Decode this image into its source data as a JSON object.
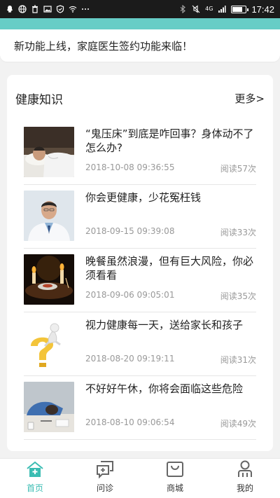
{
  "status_bar": {
    "time": "17:42",
    "network": "4G",
    "battery_level": 0.8,
    "left_icons": [
      "qq-icon",
      "globe-icon",
      "trash-icon",
      "image-icon",
      "shield-icon",
      "wifi-icon",
      "more-dots-icon"
    ],
    "right_icons": [
      "bluetooth-icon",
      "mute-icon",
      "signal-icon",
      "battery-icon"
    ]
  },
  "notice": {
    "text": "新功能上线，家庭医生签约功能来临！"
  },
  "health_section": {
    "title": "健康知识",
    "more_label": "更多>",
    "articles": [
      {
        "title": "“鬼压床”到底是咋回事？身体动不了怎么办?",
        "date": "2018-10-08 09:36:55",
        "views": "阅读57次",
        "thumb_icon": "sleeping-man-image"
      },
      {
        "title": "你会更健康，少花冤枉钱",
        "date": "2018-09-15 09:39:08",
        "views": "阅读33次",
        "thumb_icon": "doctor-portrait-image"
      },
      {
        "title": "晚餐虽然浪漫，但有巨大风险，你必须看看",
        "date": "2018-09-06 09:05:01",
        "views": "阅读35次",
        "thumb_icon": "candlelight-dinner-image"
      },
      {
        "title": "视力健康每一天，送给家长和孩子",
        "date": "2018-08-20 09:19:11",
        "views": "阅读31次",
        "thumb_icon": "figure-on-question-mark-image"
      },
      {
        "title": "不好好午休，你将会面临这些危险",
        "date": "2018-08-10 09:06:54",
        "views": "阅读49次",
        "thumb_icon": "tired-worker-image"
      }
    ]
  },
  "tab_bar": {
    "tabs": [
      {
        "label": "首页",
        "icon": "home-icon",
        "active": true
      },
      {
        "label": "问诊",
        "icon": "consult-icon",
        "active": false
      },
      {
        "label": "商城",
        "icon": "shop-icon",
        "active": false
      },
      {
        "label": "我的",
        "icon": "profile-icon",
        "active": false
      }
    ]
  },
  "colors": {
    "accent": "#3bbdb3",
    "band": "#67cdc6",
    "status_bar": "#1b1b1b",
    "meta_text": "#999999"
  }
}
